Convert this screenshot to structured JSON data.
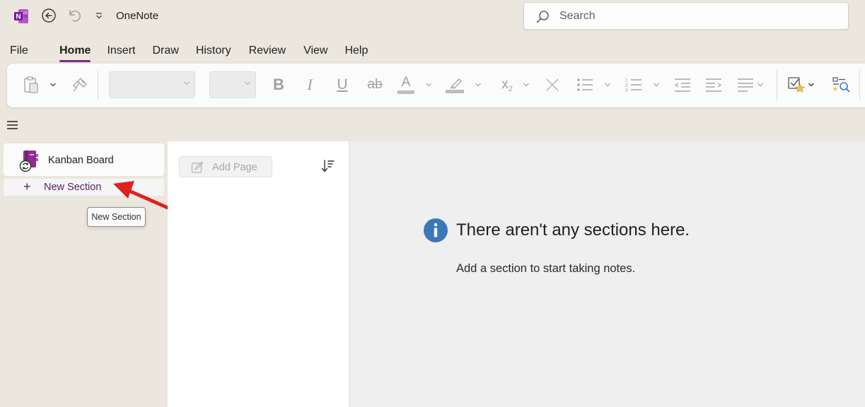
{
  "titlebar": {
    "app_title": "OneNote",
    "search_placeholder": "Search"
  },
  "tabs": [
    {
      "label": "File"
    },
    {
      "label": "Home",
      "active": true
    },
    {
      "label": "Insert"
    },
    {
      "label": "Draw"
    },
    {
      "label": "History"
    },
    {
      "label": "Review"
    },
    {
      "label": "View"
    },
    {
      "label": "Help"
    }
  ],
  "ribbon": {
    "bold_label": "B",
    "italic_label": "I",
    "underline_label": "U",
    "strike_label": "ab",
    "font_color_label": "A",
    "subscript_label": "x",
    "subscript_sub": "2",
    "font_color_accent": "#e0e0e0",
    "highlight_accent": "#d9d9d9"
  },
  "nav": {
    "notebook_label": "Kanban Board",
    "new_section_plus": "+",
    "new_section_label": "New Section",
    "tooltip": "New Section"
  },
  "pages": {
    "add_page_label": "Add Page"
  },
  "content": {
    "empty_title": "There aren't any sections here.",
    "empty_subtitle": "Add a section to start taking notes."
  },
  "colors": {
    "brand_purple": "#7b2b86",
    "arrow_red": "#e02020",
    "info_blue": "#3b78b8"
  }
}
